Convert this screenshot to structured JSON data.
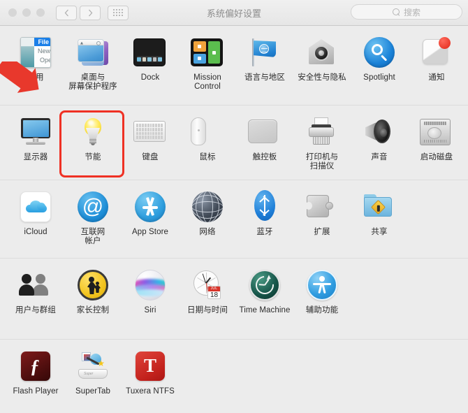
{
  "window": {
    "title": "系统偏好设置",
    "traffic_lights": [
      "close",
      "minimize",
      "zoom"
    ],
    "nav": {
      "back_label": "‹",
      "forward_label": "›",
      "grid_label": "show-all"
    },
    "search": {
      "placeholder": "搜索",
      "value": "",
      "icon": "search-icon"
    }
  },
  "annotations": {
    "arrow": {
      "color": "#e8382c",
      "name": "red-pointer-arrow"
    },
    "highlight": {
      "color": "#ef3124",
      "target": "节能",
      "name": "red-highlight-box"
    }
  },
  "rows": [
    {
      "name": "personal",
      "items": [
        {
          "label": "通用",
          "icon": "general-icon"
        },
        {
          "label": "桌面与\n屏幕保护程序",
          "icon": "desktop-screensaver-icon"
        },
        {
          "label": "Dock",
          "icon": "dock-icon"
        },
        {
          "label": "Mission\nControl",
          "icon": "mission-control-icon"
        },
        {
          "label": "语言与地区",
          "icon": "language-region-icon"
        },
        {
          "label": "安全性与隐私",
          "icon": "security-privacy-icon"
        },
        {
          "label": "Spotlight",
          "icon": "spotlight-icon"
        },
        {
          "label": "通知",
          "icon": "notifications-icon",
          "badge": true
        }
      ]
    },
    {
      "name": "hardware",
      "items": [
        {
          "label": "显示器",
          "icon": "displays-icon"
        },
        {
          "label": "节能",
          "icon": "energy-saver-icon",
          "selected": true
        },
        {
          "label": "键盘",
          "icon": "keyboard-icon"
        },
        {
          "label": "鼠标",
          "icon": "mouse-icon"
        },
        {
          "label": "触控板",
          "icon": "trackpad-icon"
        },
        {
          "label": "打印机与\n扫描仪",
          "icon": "printers-scanners-icon"
        },
        {
          "label": "声音",
          "icon": "sound-icon"
        },
        {
          "label": "启动磁盘",
          "icon": "startup-disk-icon"
        }
      ]
    },
    {
      "name": "internet-wireless",
      "items": [
        {
          "label": "iCloud",
          "icon": "icloud-icon"
        },
        {
          "label": "互联网\n帐户",
          "icon": "internet-accounts-icon"
        },
        {
          "label": "App Store",
          "icon": "app-store-icon"
        },
        {
          "label": "网络",
          "icon": "network-icon"
        },
        {
          "label": "蓝牙",
          "icon": "bluetooth-icon"
        },
        {
          "label": "扩展",
          "icon": "extensions-icon"
        },
        {
          "label": "共享",
          "icon": "sharing-icon"
        }
      ]
    },
    {
      "name": "system",
      "items": [
        {
          "label": "用户与群组",
          "icon": "users-groups-icon"
        },
        {
          "label": "家长控制",
          "icon": "parental-controls-icon"
        },
        {
          "label": "Siri",
          "icon": "siri-icon"
        },
        {
          "label": "日期与时间",
          "icon": "date-time-icon",
          "calendar_month": "JUL",
          "calendar_day": "18"
        },
        {
          "label": "Time Machine",
          "icon": "time-machine-icon"
        },
        {
          "label": "辅助功能",
          "icon": "accessibility-icon"
        }
      ]
    },
    {
      "name": "third-party",
      "items": [
        {
          "label": "Flash Player",
          "icon": "flash-player-icon",
          "glyph": "ƒ"
        },
        {
          "label": "SuperTab",
          "icon": "supertab-icon"
        },
        {
          "label": "Tuxera NTFS",
          "icon": "tuxera-ntfs-icon",
          "glyph": "T"
        }
      ]
    }
  ],
  "general_icon_text": {
    "line1": "File",
    "line2": "New",
    "line3": "Ope"
  }
}
